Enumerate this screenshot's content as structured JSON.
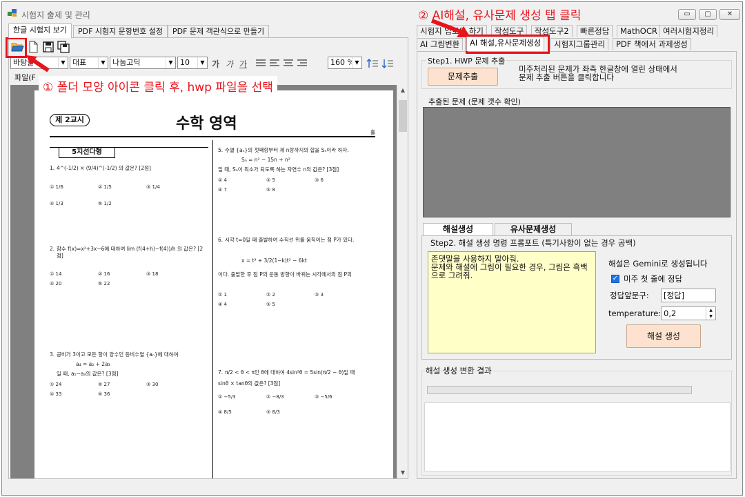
{
  "window": {
    "title": "시험지 출제 및 관리",
    "controls": {
      "minimize": "▭",
      "maximize": "▢",
      "close": "✕"
    }
  },
  "left": {
    "tabs": [
      "한글 시험지 보기",
      "PDF 시험지 문항번호 설정",
      "PDF 문제 객관식으로 만들기"
    ],
    "toolbar_icons": [
      "open-folder-icon",
      "new-document-icon",
      "save-icon",
      "save-all-icon"
    ],
    "style_combo": "바탕글",
    "lang_combo": "대표",
    "font_combo": "나눔고딕",
    "size_combo": "10",
    "format_glyphs": [
      "가",
      "가",
      "가"
    ],
    "zoom_combo": "160 %",
    "menu_label": "파일(F",
    "document": {
      "period_label": "제 2교시",
      "subject_title": "수학 영역",
      "page_mark": "홀",
      "section_label": "5지선다형",
      "questions": [
        {
          "num": "1.",
          "text": "4^(-1/2) × (9/4)^(-1/2) 의 값은? [2점]",
          "choices": [
            "① 1/6",
            "② 1/5",
            "③ 1/4",
            "④ 1/3",
            "⑤ 1/2"
          ]
        },
        {
          "num": "2.",
          "text": "함수 f(x)=x²+3x−6에 대하여 lim (f(4+h)−f(4))/h 의 값은? [2점]",
          "choices": [
            "① 14",
            "② 16",
            "③ 18",
            "④ 20",
            "⑤ 22"
          ]
        },
        {
          "num": "3.",
          "text": "공비가 3이고 모든 항이 양수인 등비수열 {aₙ}에 대하여",
          "sub": "a₄ = a₂ + 2a₃",
          "tail": "일 때, a₅−a₃의 값은? [3점]",
          "choices": [
            "① 24",
            "② 27",
            "③ 30",
            "④ 33",
            "⑤ 36"
          ]
        },
        {
          "num": "5.",
          "text": "수열 {aₙ}의 첫째항부터 제 n항까지의 합을 Sₙ이라 하자.",
          "sub": "Sₙ = n² − 15n + n²",
          "tail": "일 때, Sₙ이 최소가 되도록 하는 자연수 n의 값은? [3점]",
          "choices": [
            "① 4",
            "② 5",
            "③ 6",
            "④ 7",
            "⑤ 8"
          ]
        },
        {
          "num": "6.",
          "text": "시각 t=0일 때 출발하여 수직선 위를 움직이는 점 P가 있다.",
          "sub": "x = t³ + 3/2(1−k)t² − 6kt",
          "tail": "이다. 출발한 후 점 P의 운동 방향이 바뀌는 시각에서의 점 P의",
          "choices": [
            "① 1",
            "② 2",
            "③ 3",
            "④ 4",
            "⑤ 5"
          ]
        },
        {
          "num": "7.",
          "text": "π/2 < θ < π인 θ에 대하여 4sin²θ = 5sin(π/2 − θ)일 때",
          "tail": "sinθ × tanθ의 값은? [3점]",
          "choices": [
            "① −5/3",
            "② −8/3",
            "③ −5/6",
            "④ 8/5",
            "⑤ 8/3"
          ]
        }
      ]
    }
  },
  "right": {
    "tabs_row1": [
      "시험지 업로드 하기",
      "작성도구",
      "작성도구2",
      "빠른정답",
      "MathOCR",
      "여러시험지정리"
    ],
    "tabs_row2": [
      "AI 그림변환",
      "AI 해설,유사문제생성",
      "시험지그룹관리",
      "PDF 책에서 과제생성"
    ],
    "active_tab": "AI 해설,유사문제생성",
    "step1": {
      "title": "Step1. HWP 문제 추출",
      "button": "문제추출",
      "description": "미주처리된 문제가 좌측 한글창에 열린 상태에서\n문제 추출 버튼을 클릭합니다"
    },
    "extracted": {
      "title": "추출된 문제 (문제 갯수 확인)"
    },
    "subtabs": [
      "해설생성",
      "유사문제생성"
    ],
    "step2": {
      "title": "Step2. 해설 생성 명령 프롬포트 (특기사항이 없는 경우 공백)",
      "prompt": "존댓말을 사용하지 말아줘.\n문제와 해설에 그림이 필요한 경우, 그림은 흑백으로 그려줘.",
      "model_note": "해설은 Gemini로 생성됩니다",
      "checkbox_label": "미주 첫 줄에 정답",
      "checkbox_checked": true,
      "prefix_label": "정답앞문구:",
      "prefix_value": "[정답]",
      "temperature_label": "temperature:",
      "temperature_value": "0,2",
      "generate_button": "해설 생성"
    },
    "result": {
      "title": "해설 생성 변환 결과",
      "progress": 0
    }
  },
  "annotations": {
    "callout1": "① 폴더 모양 아이콘 클릭 후, hwp 파일을 선택",
    "callout2": "② AI해설, 유사문제 생성 탭 클릭",
    "color": "#e8141c"
  }
}
